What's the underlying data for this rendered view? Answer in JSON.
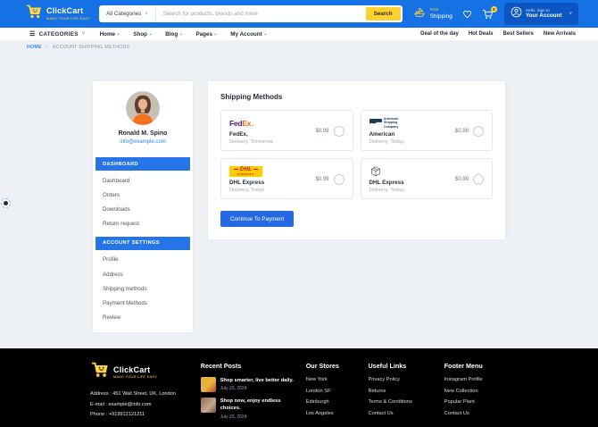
{
  "icons": {
    "hamburger": "☰",
    "chevron_down": "˅",
    "plus": "+",
    "breadcrumb_separator": "›"
  },
  "colors": {
    "topbar_blue": "#1671e4",
    "accent_blue": "#2575e8",
    "brand_yellow": "#fed12e",
    "footer_black": "#000000",
    "fedex_purple": "#4d148c",
    "fedex_orange": "#ff6200",
    "dhl_yellow": "#ffcc00",
    "dhl_red": "#d40511"
  },
  "topbar": {
    "brand_name": "ClickCart",
    "brand_tagline": "MAKE YOUR LIFE EASY",
    "search_category": "All Categories",
    "search_placeholder": "Search for products, brands and more",
    "search_button": "Search",
    "free_shipping_top": "Free",
    "free_shipping_bottom": "Shipping",
    "cart_count": "0",
    "account_greeting": "Hello, Sign In",
    "account_label": "Your Account"
  },
  "navbar": {
    "categories": "CATEGORIES",
    "items": [
      {
        "label": "Home"
      },
      {
        "label": "Shop"
      },
      {
        "label": "Blog"
      },
      {
        "label": "Pages"
      },
      {
        "label": "My Account"
      }
    ],
    "deals": [
      {
        "label": "Deal of the day"
      },
      {
        "label": "Hot Deals"
      },
      {
        "label": "Best Sellers"
      },
      {
        "label": "New Arrivals"
      }
    ]
  },
  "breadcrumb": {
    "home": "HOME",
    "current": "ACCOUNT SHIPPING METHODS"
  },
  "sidebar": {
    "name": "Ronald M. Spino",
    "email": "info@example.com",
    "section1_header": "DASHBOARD",
    "section1_items": [
      "Dashboard",
      "Orders",
      "Downloads",
      "Return request"
    ],
    "section2_header": "ACCOUNT SETTINGS",
    "section2_items": [
      "Profile",
      "Address",
      "Shipping methods",
      "Payment Methods",
      "Review"
    ]
  },
  "main": {
    "title": "Shipping Methods",
    "continue_button": "Continue To Payment",
    "methods": [
      {
        "logo": "fedex-logo",
        "name": "FedEx,",
        "delivery": "Delivery, Tomorrow",
        "price": "$0.99"
      },
      {
        "logo": "american-shipping-logo",
        "name": "American",
        "delivery": "Delivery, Today",
        "price": "$0.99"
      },
      {
        "logo": "dhl-logo",
        "name": "DHL Express",
        "delivery": "Delivery, Today",
        "price": "$0.99"
      },
      {
        "logo": "package-box-icon",
        "name": "DHL Express",
        "delivery": "Delivery, Today",
        "price": "$0.99"
      }
    ],
    "logos": {
      "fedex_fed": "Fed",
      "fedex_ex": "Ex",
      "fedex_dot": ".",
      "asc_line1": "American",
      "asc_line2": "Shipping",
      "asc_line3": "Company",
      "dhl_word": "DHL",
      "dhl_sub": "EXPRESS"
    }
  },
  "footer": {
    "brand_name": "ClickCart",
    "brand_tagline": "MAKE YOUR LIFE EASY",
    "address": "Address : 451 Wall Street, UK, London",
    "email": "E-mail : example@info.com",
    "phone": "Phone : +919912121211",
    "recent_posts_title": "Recent Posts",
    "posts": [
      {
        "title": "Shop smarter, live better daily.",
        "date": "July 23, 2024"
      },
      {
        "title": "Shop now, enjoy endless choices.",
        "date": "July 23, 2024"
      }
    ],
    "stores_title": "Our Stores",
    "stores": [
      "New York",
      "London SF",
      "Edinburgh",
      "Los Angeles"
    ],
    "useful_title": "Useful Links",
    "useful": [
      "Privacy Policy",
      "Returns",
      "Terms & Conditions",
      "Contact Us"
    ],
    "menu_title": "Footer Menu",
    "menu": [
      "Instagram Profile",
      "New Collection",
      "Popular Plant",
      "Contact Us"
    ]
  }
}
